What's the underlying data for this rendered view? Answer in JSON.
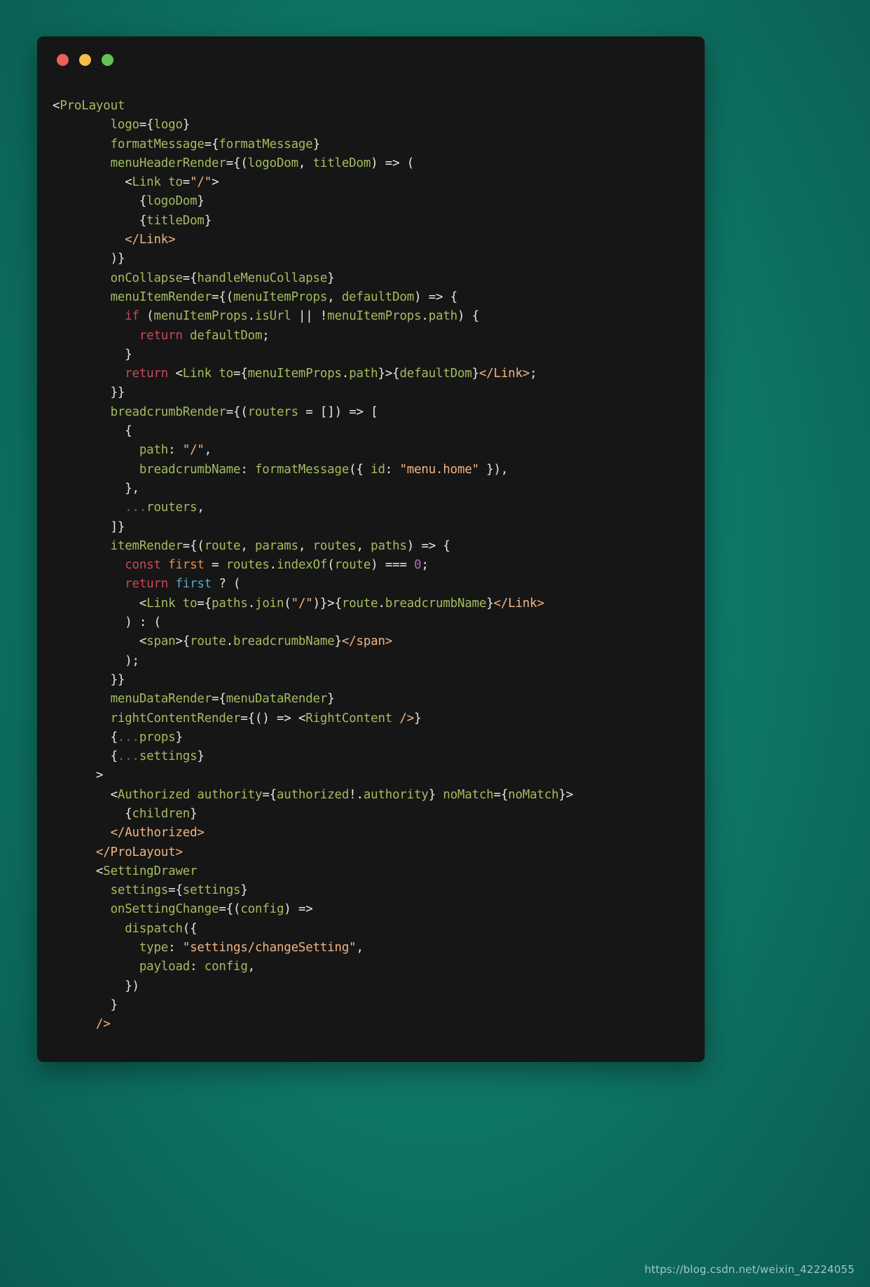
{
  "window": {
    "traffic_lights": [
      {
        "name": "close",
        "color": "#ec5f5a"
      },
      {
        "name": "minimize",
        "color": "#f5bd4f"
      },
      {
        "name": "maximize",
        "color": "#61c454"
      }
    ],
    "background_color": "#128270",
    "surface_color": "#161616"
  },
  "watermark": {
    "text": "https://blog.csdn.net/weixin_42224055"
  },
  "theme": {
    "plain": "#e8e8e3",
    "tag": "#a3bd5f",
    "closing_tag": "#f2b380",
    "string": "#f2b380",
    "keyword": "#c9485b",
    "declaration": "#dd8f4b",
    "usage": "#5ba6c4",
    "number": "#a972b8",
    "dim": "#6d6d68"
  },
  "code": {
    "language": "jsx",
    "lines": [
      "<ProLayout",
      "        logo={logo}",
      "        formatMessage={formatMessage}",
      "        menuHeaderRender={(logoDom, titleDom) => (",
      "          <Link to=\"/\">",
      "            {logoDom}",
      "            {titleDom}",
      "          </Link>",
      "        )}",
      "        onCollapse={handleMenuCollapse}",
      "        menuItemRender={(menuItemProps, defaultDom) => {",
      "          if (menuItemProps.isUrl || !menuItemProps.path) {",
      "            return defaultDom;",
      "          }",
      "          return <Link to={menuItemProps.path}>{defaultDom}</Link>;",
      "        }}",
      "        breadcrumbRender={(routers = []) => [",
      "          {",
      "            path: \"/\",",
      "            breadcrumbName: formatMessage({ id: \"menu.home\" }),",
      "          },",
      "          ...routers,",
      "        ]}",
      "        itemRender={(route, params, routes, paths) => {",
      "          const first = routes.indexOf(route) === 0;",
      "          return first ? (",
      "            <Link to={paths.join(\"/\")}>{route.breadcrumbName}</Link>",
      "          ) : (",
      "            <span>{route.breadcrumbName}</span>",
      "          );",
      "        }}",
      "        menuDataRender={menuDataRender}",
      "        rightContentRender={() => <RightContent />}",
      "        {...props}",
      "        {...settings}",
      "      >",
      "        <Authorized authority={authorized!.authority} noMatch={noMatch}>",
      "          {children}",
      "        </Authorized>",
      "      </ProLayout>",
      "      <SettingDrawer",
      "        settings={settings}",
      "        onSettingChange={(config) =>",
      "          dispatch({",
      "            type: \"settings/changeSetting\",",
      "            payload: config,",
      "          })",
      "        }",
      "      />"
    ]
  }
}
